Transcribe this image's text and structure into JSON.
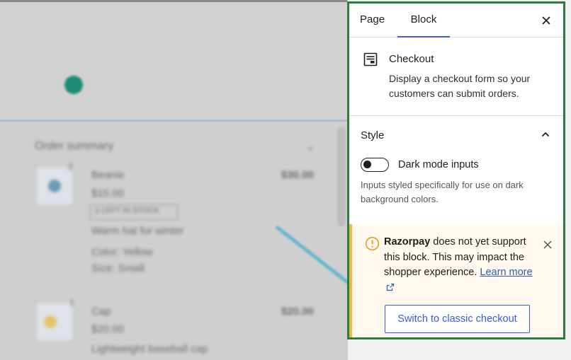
{
  "tabs": {
    "page": "Page",
    "block": "Block"
  },
  "block": {
    "title": "Checkout",
    "description": "Display a checkout form so your customers can submit orders."
  },
  "style_section": {
    "label": "Style"
  },
  "dark_mode": {
    "label": "Dark mode inputs",
    "enabled": false,
    "help": "Inputs styled specifically for use on dark background colors."
  },
  "notice": {
    "plugin": "Razorpay",
    "text": " does not yet support this block. This may impact the shopper experience. ",
    "link": "Learn more",
    "button": "Switch to classic checkout"
  },
  "canvas": {
    "order_summary": "Order summary",
    "items": [
      {
        "qty": "2",
        "name": "Beanie",
        "price": "$15.00",
        "total": "$30.00",
        "badge": "2 LEFT IN STOCK",
        "desc": "Warm hat for winter",
        "color": "Color: Yellow",
        "size": "Size: Small"
      },
      {
        "qty": "1",
        "name": "Cap",
        "price": "$20.00",
        "total": "$20.00",
        "desc": "Lightweight baseball cap"
      }
    ]
  },
  "icons": [
    "checkout-block-icon",
    "close-icon",
    "chevron-up-icon",
    "warning-icon",
    "external-link-icon",
    "notice-close-icon"
  ],
  "colors": {
    "accent": "#3858e9",
    "panel_border": "#2e7d3d",
    "notice_bg": "#fef8ee",
    "notice_border": "#f0b849"
  }
}
